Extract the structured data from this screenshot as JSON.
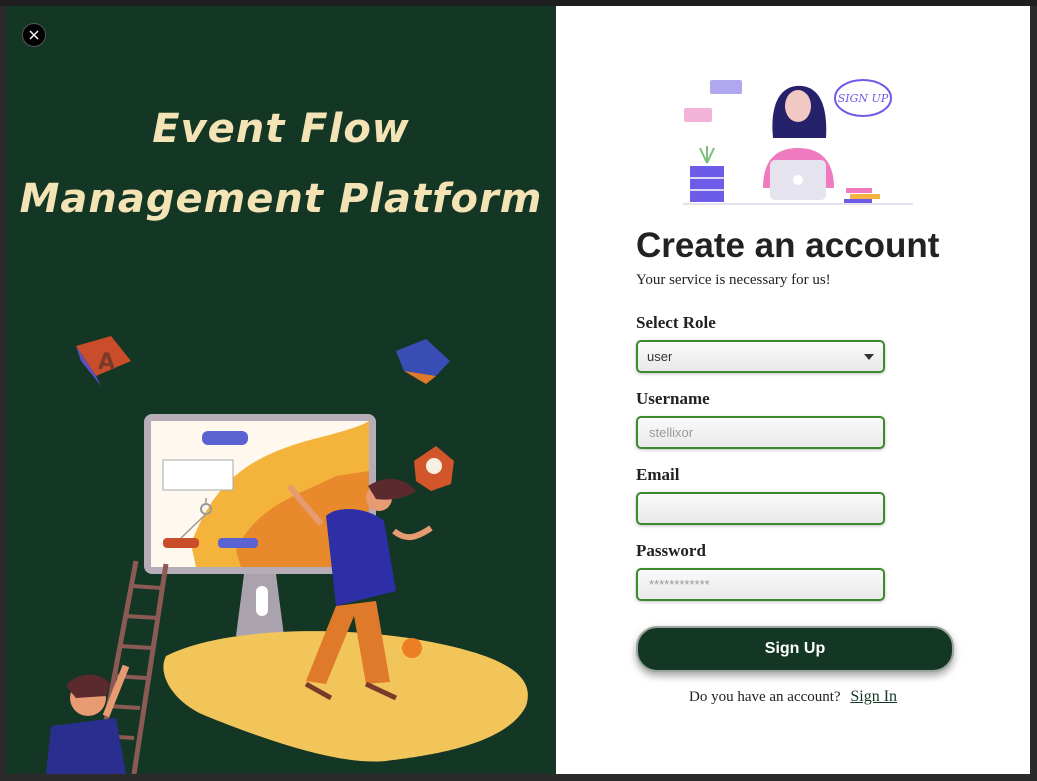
{
  "brand": {
    "line1": "Event Flow",
    "line2": "Management Platform"
  },
  "hero_badge": "SIGN UP",
  "form": {
    "heading": "Create an account",
    "subheading": "Your service is necessary for us!",
    "role_label": "Select Role",
    "role_value": "user",
    "username_label": "Username",
    "username_placeholder": "stellixor",
    "email_label": "Email",
    "email_placeholder": "",
    "password_label": "Password",
    "password_placeholder": "************",
    "submit_label": "Sign Up",
    "signin_prompt": "Do you have an account?",
    "signin_link": "Sign In"
  },
  "icons": {
    "close": "close-icon",
    "dropdown": "chevron-down-icon"
  },
  "colors": {
    "brand_dark": "#143625",
    "accent_green": "#3c8a2e",
    "title_cream": "#f3e3b5"
  }
}
